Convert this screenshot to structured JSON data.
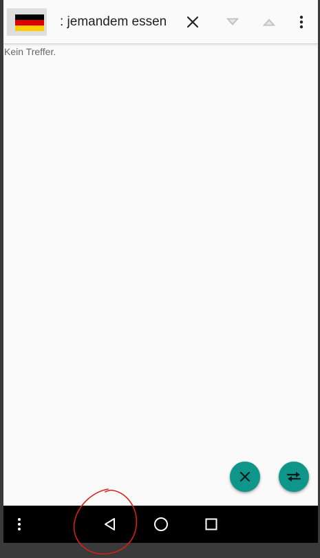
{
  "search": {
    "query_text": ": jemandem essen"
  },
  "results": {
    "status": "Kein Treffer."
  },
  "flag": {
    "colors": [
      "#000000",
      "#dd0000",
      "#ffce00"
    ]
  },
  "icons": {
    "clear": "close-icon",
    "next": "arrow-down-icon",
    "previous": "arrow-up-icon",
    "menu": "more-vertical-icon",
    "fab_clear": "close-icon",
    "fab_swap": "swap-icon",
    "nav_menu": "more-vertical-icon",
    "nav_back": "back-icon",
    "nav_home": "home-icon",
    "nav_recents": "recents-icon"
  },
  "colors": {
    "accent": "#0f968a",
    "annotation": "#d62018"
  }
}
